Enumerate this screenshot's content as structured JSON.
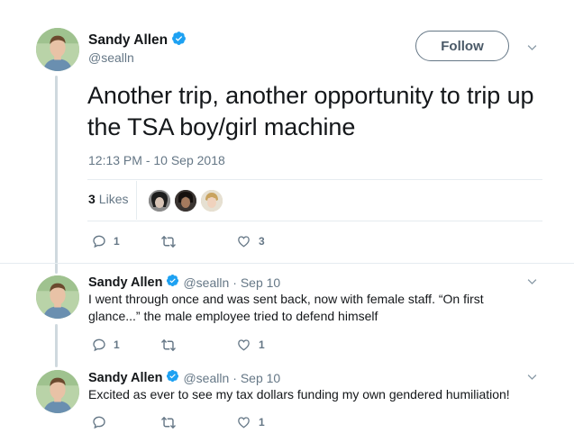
{
  "colors": {
    "verified": "#1da1f2",
    "muted": "#657786",
    "text": "#14171a",
    "line": "#cfd9de"
  },
  "main_tweet": {
    "author": {
      "name": "Sandy Allen",
      "handle": "@sealln",
      "verified": true
    },
    "follow_label": "Follow",
    "text": "Another trip, another opportunity to trip up the TSA boy/girl machine",
    "timestamp": "12:13 PM - 10 Sep 2018",
    "likes_count": "3",
    "likes_label": "Likes",
    "actions": {
      "reply_count": "1",
      "retweet_count": "",
      "like_count": "3"
    }
  },
  "replies": [
    {
      "author": {
        "name": "Sandy Allen",
        "handle": "@sealln",
        "verified": true
      },
      "date": "· Sep 10",
      "text_line1": "I went through once and was sent back, now with female staff. “On first",
      "text_line2": "glance...” the male employee tried to defend himself",
      "actions": {
        "reply_count": "1",
        "retweet_count": "",
        "like_count": "1"
      }
    },
    {
      "author": {
        "name": "Sandy Allen",
        "handle": "@sealln",
        "verified": true
      },
      "date": "· Sep 10",
      "text_line1": "Excited as ever to see my tax dollars funding my own gendered humiliation!",
      "actions": {
        "reply_count": "",
        "retweet_count": "",
        "like_count": "1"
      }
    }
  ]
}
